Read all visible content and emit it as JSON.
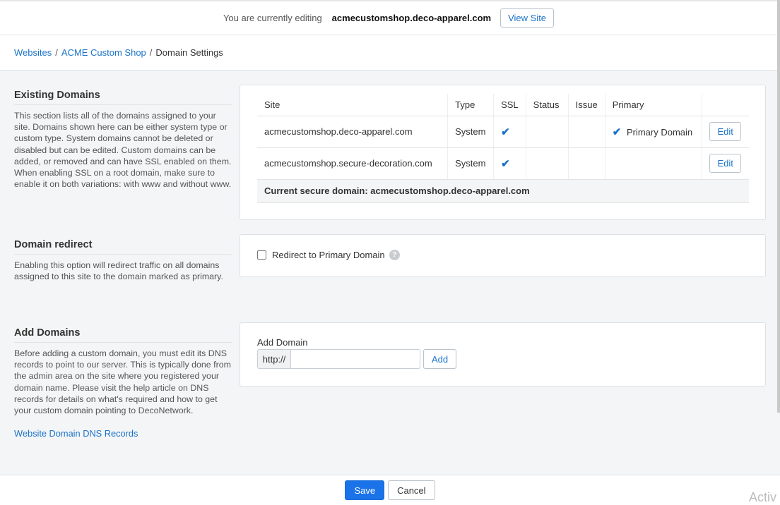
{
  "topbar": {
    "editing_text": "You are currently editing",
    "site_domain": "acmecustomshop.deco-apparel.com",
    "view_site_label": "View Site"
  },
  "breadcrumb": {
    "items": [
      "Websites",
      "ACME Custom Shop"
    ],
    "current": "Domain Settings",
    "separator": "/"
  },
  "existing_domains": {
    "title": "Existing Domains",
    "description": "This section lists all of the domains assigned to your site. Domains shown here can be either system type or custom type. System domains cannot be deleted or disabled but can be edited. Custom domains can be added, or removed and can have SSL enabled on them. When enabling SSL on a root domain, make sure to enable it on both variations: with www and without www.",
    "columns": [
      "Site",
      "Type",
      "SSL",
      "Status",
      "Issue",
      "Primary"
    ],
    "rows": [
      {
        "site": "acmecustomshop.deco-apparel.com",
        "type": "System",
        "ssl_mark": "✔",
        "status": "",
        "issue": "",
        "primary_mark": "✔",
        "primary_label": "Primary Domain",
        "edit_label": "Edit"
      },
      {
        "site": "acmecustomshop.secure-decoration.com",
        "type": "System",
        "ssl_mark": "✔",
        "status": "",
        "issue": "",
        "primary_mark": "",
        "primary_label": "",
        "edit_label": "Edit"
      }
    ],
    "secure_domain_text": "Current secure domain: acmecustomshop.deco-apparel.com"
  },
  "domain_redirect": {
    "title": "Domain redirect",
    "description": "Enabling this option will redirect traffic on all domains assigned to this site to the domain marked as primary.",
    "checkbox_label": "Redirect to Primary Domain",
    "checked": false,
    "help_glyph": "?"
  },
  "add_domains": {
    "title": "Add Domains",
    "description": "Before adding a custom domain, you must edit its DNS records to point to our server. This is typically done from the admin area on the site where you registered your domain name. Please visit the help article on DNS records for details on what's required and how to get your custom domain pointing to DecoNetwork.",
    "link_label": "Website Domain DNS Records",
    "field_label": "Add Domain",
    "prefix": "http://",
    "input_value": "",
    "add_label": "Add"
  },
  "footer": {
    "save_label": "Save",
    "cancel_label": "Cancel"
  },
  "watermark": "Activ"
}
